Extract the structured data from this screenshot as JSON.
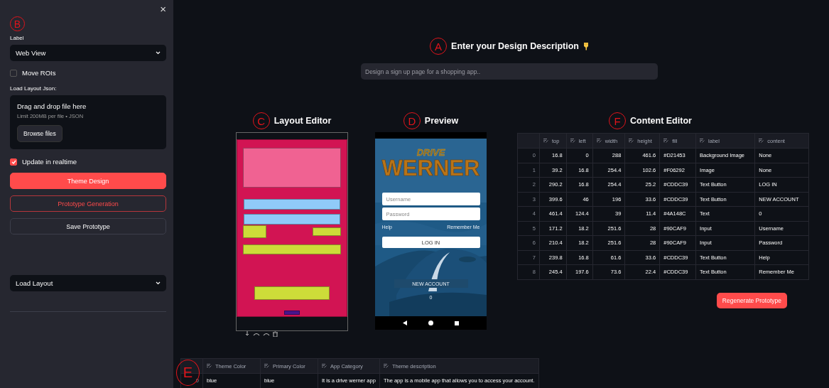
{
  "sidebar": {
    "close": "×",
    "marker": "B",
    "label": "Label",
    "label_select": "Web View",
    "move_rois": {
      "label": "Move ROIs",
      "checked": false
    },
    "upload": {
      "label": "Load Layout Json:",
      "title": "Drag and drop file here",
      "limit": "Limit 200MB per file • JSON",
      "button": "Browse files"
    },
    "realtime": {
      "label": "Update in realtime",
      "checked": true
    },
    "buttons": [
      {
        "label": "Theme Design",
        "kind": "primary"
      },
      {
        "label": "Prototype Generation",
        "kind": "outline"
      },
      {
        "label": "Save Prototype",
        "kind": "secondary"
      }
    ],
    "load_select": "Load Layout"
  },
  "header": {
    "marker": "A",
    "title": "Enter your Design Description"
  },
  "prompt": {
    "placeholder": "Design a sign up page for a shopping app.."
  },
  "layout_editor": {
    "marker": "C",
    "title": "Layout Editor"
  },
  "preview": {
    "marker": "D",
    "title": "Preview",
    "logo_top": "DRIVE",
    "logo": "WERNER",
    "username": "Username",
    "password": "Password",
    "help": "Help",
    "remember": "Remember Me",
    "login": "LOG IN",
    "new_account": "NEW ACCOUNT",
    "counter": "0"
  },
  "content_editor": {
    "marker": "F",
    "title": "Content Editor",
    "columns": [
      "top",
      "left",
      "width",
      "height",
      "fill",
      "label",
      "content"
    ],
    "rows": [
      {
        "index": "0",
        "cells": [
          "16.8",
          "0",
          "288",
          "461.6",
          "#D21453",
          "Background Image",
          "None"
        ]
      },
      {
        "index": "1",
        "cells": [
          "39.2",
          "16.8",
          "254.4",
          "102.6",
          "#F06292",
          "Image",
          "None"
        ]
      },
      {
        "index": "2",
        "cells": [
          "290.2",
          "16.8",
          "254.4",
          "25.2",
          "#CDDC39",
          "Text Button",
          "LOG IN"
        ]
      },
      {
        "index": "3",
        "cells": [
          "399.6",
          "46",
          "196",
          "33.6",
          "#CDDC39",
          "Text Button",
          "NEW ACCOUNT"
        ]
      },
      {
        "index": "4",
        "cells": [
          "461.4",
          "124.4",
          "39",
          "11.4",
          "#4A148C",
          "Text",
          "0"
        ]
      },
      {
        "index": "5",
        "cells": [
          "171.2",
          "18.2",
          "251.6",
          "28",
          "#90CAF9",
          "Input",
          "Username"
        ]
      },
      {
        "index": "6",
        "cells": [
          "210.4",
          "18.2",
          "251.6",
          "28",
          "#90CAF9",
          "Input",
          "Password"
        ]
      },
      {
        "index": "7",
        "cells": [
          "239.8",
          "16.8",
          "61.6",
          "33.6",
          "#CDDC39",
          "Text Button",
          "Help"
        ]
      },
      {
        "index": "8",
        "cells": [
          "245.4",
          "197.6",
          "73.6",
          "22.4",
          "#CDDC39",
          "Text Button",
          "Remember Me"
        ]
      }
    ],
    "regenerate": "Regenerate Prototype"
  },
  "theme_table": {
    "marker": "E",
    "columns": [
      "Theme Color",
      "Primary Color",
      "App Category",
      "Theme description"
    ],
    "rows": [
      {
        "index": "0",
        "cells": [
          "blue",
          "blue",
          "It is a drive werner app",
          "The app is a mobile app that allows you to access your account."
        ]
      }
    ]
  }
}
